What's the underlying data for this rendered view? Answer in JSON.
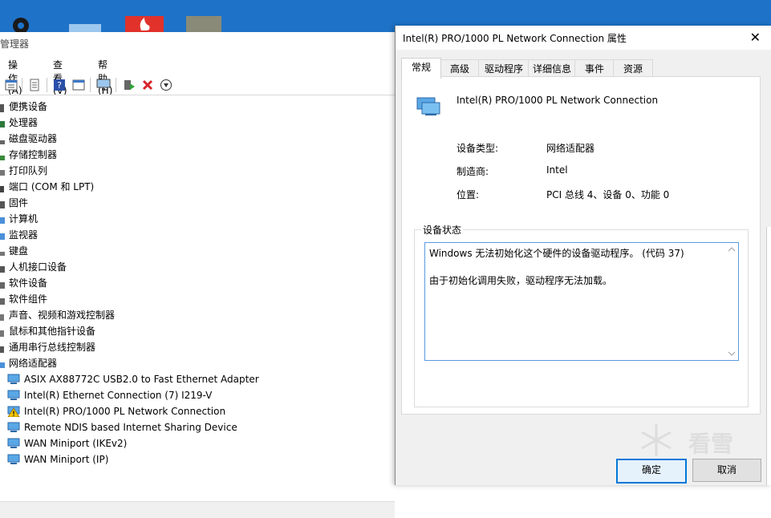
{
  "device_manager": {
    "title": "管理器",
    "menu": [
      "操作(A)",
      "查看(V)",
      "帮助(H)"
    ],
    "categories": [
      "便携设备",
      "处理器",
      "磁盘驱动器",
      "存储控制器",
      "打印队列",
      "端口 (COM 和 LPT)",
      "固件",
      "计算机",
      "监视器",
      "键盘",
      "人机接口设备",
      "软件设备",
      "软件组件",
      "声音、视频和游戏控制器",
      "鼠标和其他指针设备",
      "通用串行总线控制器",
      "网络适配器"
    ],
    "network_adapters": [
      {
        "name": "ASIX AX88772C USB2.0 to Fast Ethernet Adapter",
        "icon": "network-adapter-icon"
      },
      {
        "name": "Intel(R) Ethernet Connection (7) I219-V",
        "icon": "network-adapter-icon"
      },
      {
        "name": "Intel(R) PRO/1000 PL Network Connection",
        "icon": "network-adapter-warning-icon"
      },
      {
        "name": "Remote NDIS based Internet Sharing Device",
        "icon": "network-adapter-icon"
      },
      {
        "name": "WAN Miniport (IKEv2)",
        "icon": "network-adapter-icon"
      },
      {
        "name": "WAN Miniport (IP)",
        "icon": "network-adapter-icon"
      }
    ]
  },
  "dialog": {
    "title": "Intel(R) PRO/1000 PL Network Connection 属性",
    "tabs": [
      "常规",
      "高级",
      "驱动程序",
      "详细信息",
      "事件",
      "资源"
    ],
    "active_tab": "常规",
    "device_name": "Intel(R) PRO/1000 PL Network Connection",
    "props": [
      {
        "label": "设备类型:",
        "value": "网络适配器"
      },
      {
        "label": "制造商:",
        "value": "Intel"
      },
      {
        "label": "位置:",
        "value": "PCI 总线 4、设备 0、功能 0"
      }
    ],
    "status_group": "设备状态",
    "status_lines": [
      "Windows 无法初始化这个硬件的设备驱动程序。 (代码 37)",
      "由于初始化调用失败，驱动程序无法加载。"
    ],
    "ok": "确定",
    "cancel": "取消"
  },
  "watermark": "看雪",
  "colors": {
    "accent": "#0078d7",
    "desktop": "#1e73c8",
    "warning": "#f5c400"
  }
}
